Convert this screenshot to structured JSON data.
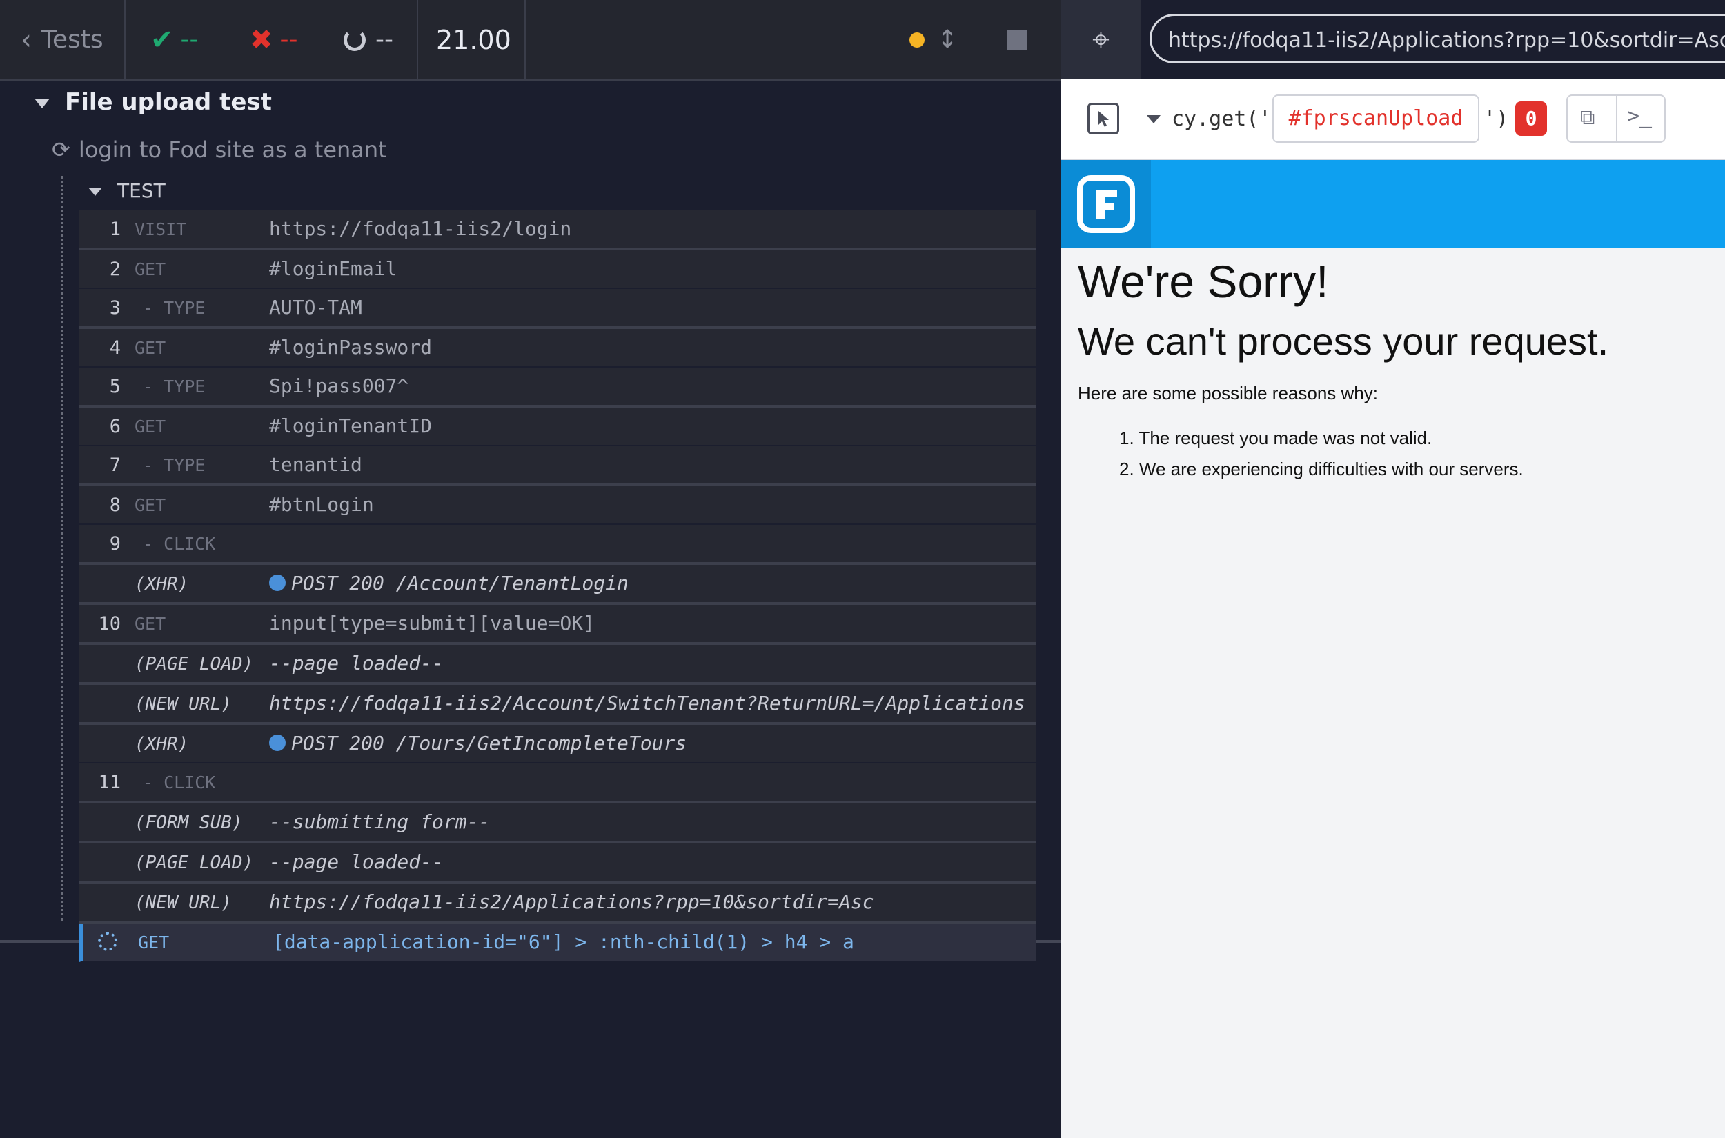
{
  "topbar": {
    "tests_label": "Tests",
    "passed": "--",
    "failed": "--",
    "pending": "--",
    "duration": "21.00"
  },
  "suite": {
    "title": "File upload test",
    "test_title": "login to Fod site as a tenant",
    "hook_label": "TEST"
  },
  "commands": [
    {
      "num": "1",
      "name": "VISIT",
      "msg": "https://fodqa11-iis2/login"
    },
    {
      "num": "2",
      "name": "GET",
      "msg": "#loginEmail"
    },
    {
      "num": "3",
      "name": "- TYPE",
      "msg": "AUTO-TAM"
    },
    {
      "num": "4",
      "name": "GET",
      "msg": "#loginPassword"
    },
    {
      "num": "5",
      "name": "- TYPE",
      "msg": "Spi!pass007^"
    },
    {
      "num": "6",
      "name": "GET",
      "msg": "#loginTenantID"
    },
    {
      "num": "7",
      "name": "- TYPE",
      "msg": "tenantid"
    },
    {
      "num": "8",
      "name": "GET",
      "msg": "#btnLogin"
    },
    {
      "num": "9",
      "name": "- CLICK",
      "msg": ""
    },
    {
      "num": "",
      "name": "(XHR)",
      "msg": "POST 200 /Account/TenantLogin"
    },
    {
      "num": "10",
      "name": "GET",
      "msg": "input[type=submit][value=OK]"
    },
    {
      "num": "",
      "name": "(PAGE LOAD)",
      "msg": "--page loaded--"
    },
    {
      "num": "",
      "name": "(NEW URL)",
      "msg": "https://fodqa11-iis2/Account/SwitchTenant?ReturnURL=/Applications"
    },
    {
      "num": "",
      "name": "(XHR)",
      "msg": "POST 200 /Tours/GetIncompleteTours"
    },
    {
      "num": "11",
      "name": "- CLICK",
      "msg": ""
    },
    {
      "num": "",
      "name": "(FORM SUB)",
      "msg": "--submitting form--"
    },
    {
      "num": "",
      "name": "(PAGE LOAD)",
      "msg": "--page loaded--"
    },
    {
      "num": "",
      "name": "(NEW URL)",
      "msg": "https://fodqa11-iis2/Applications?rpp=10&sortdir=Asc"
    },
    {
      "num": "",
      "name": "GET",
      "msg": "[data-application-id=\"6\"] > :nth-child(1) > h4 > a"
    }
  ],
  "preview": {
    "url": "https://fodqa11-iis2/Applications?rpp=10&sortdir=Asc",
    "selector_prefix": "cy.get('",
    "selector_value": "#fprscanUpload",
    "selector_suffix": "')",
    "match_count": "0",
    "heading1": "We're Sorry!",
    "heading2": "We can't process your request.",
    "reasons_intro": "Here are some possible reasons why:",
    "reasons": [
      "1. The request you made was not valid.",
      "2. We are experiencing difficulties with our servers."
    ]
  },
  "colors": {
    "pass": "#1fa971",
    "fail": "#e2322c",
    "running": "#f5b324",
    "accent": "#3b8fdb",
    "app_header": "#0ea0f0"
  }
}
